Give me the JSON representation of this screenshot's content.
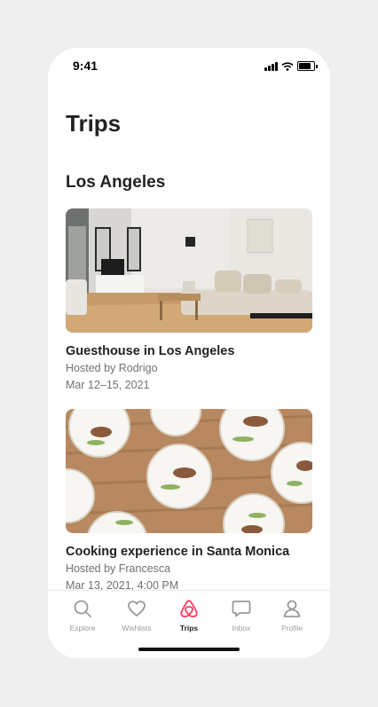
{
  "status_bar": {
    "time": "9:41"
  },
  "page": {
    "title": "Trips"
  },
  "trips": {
    "section_title": "Los Angeles",
    "items": [
      {
        "title": "Guesthouse in Los Angeles",
        "host": "Hosted by Rodrigo",
        "dates": "Mar 12–15, 2021"
      },
      {
        "title": "Cooking experience in Santa Monica",
        "host": "Hosted by Francesca",
        "dates": "Mar 13, 2021, 4:00 PM"
      }
    ]
  },
  "tab_bar": {
    "tabs": [
      {
        "label": "Explore",
        "icon": "search-icon",
        "active": false
      },
      {
        "label": "Wishlists",
        "icon": "heart-icon",
        "active": false
      },
      {
        "label": "Trips",
        "icon": "airbnb-logo-icon",
        "active": true
      },
      {
        "label": "Inbox",
        "icon": "chat-bubble-icon",
        "active": false
      },
      {
        "label": "Profile",
        "icon": "profile-icon",
        "active": false
      }
    ]
  },
  "colors": {
    "accent": "#FF385C",
    "text": "#222222",
    "muted": "#717171",
    "inactive_tab": "#9A9A9A"
  }
}
